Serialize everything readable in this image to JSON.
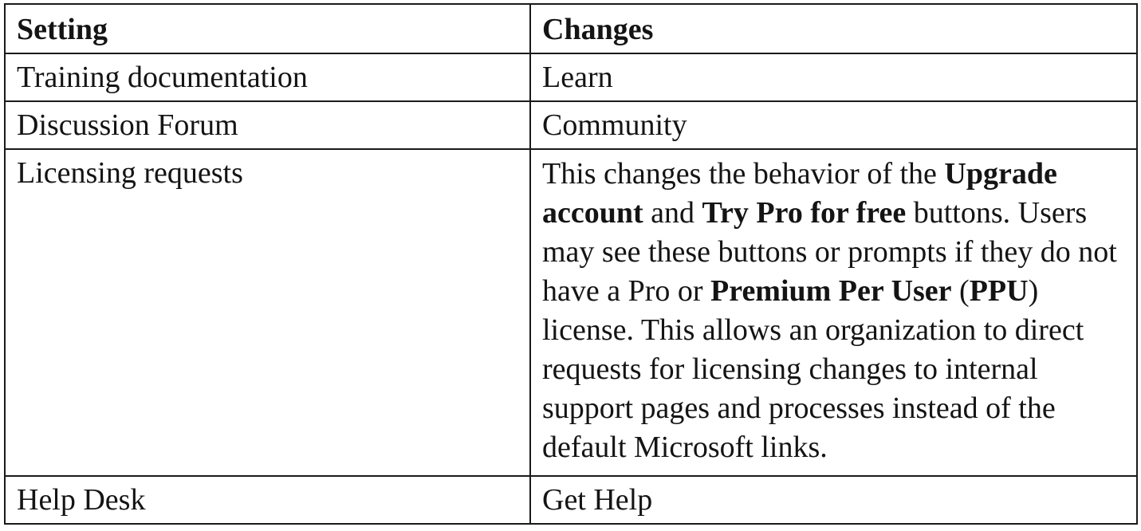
{
  "table": {
    "headers": {
      "setting": "Setting",
      "changes": "Changes"
    },
    "rows": [
      {
        "setting": "Training documentation",
        "changes": "Learn"
      },
      {
        "setting": "Discussion Forum",
        "changes": "Community"
      },
      {
        "setting": "Licensing requests",
        "changes_parts": [
          "This changes the behavior of the ",
          "Upgrade account",
          " and ",
          "Try Pro for free",
          " buttons. Users may see these buttons or prompts if they do not have a Pro or ",
          "Premium Per User",
          " (",
          "PPU",
          ") license. This allows an organization to direct requests for licensing changes to internal support pages and processes instead of the default Microsoft links."
        ]
      },
      {
        "setting": "Help Desk",
        "changes": "Get Help"
      }
    ]
  }
}
